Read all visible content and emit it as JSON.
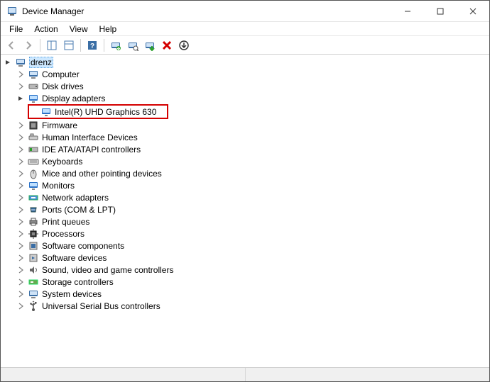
{
  "window": {
    "title": "Device Manager"
  },
  "menu": {
    "file": "File",
    "action": "Action",
    "view": "View",
    "help": "Help"
  },
  "tree": {
    "root": "drenz",
    "computer": "Computer",
    "disk_drives": "Disk drives",
    "display_adapters": "Display adapters",
    "intel_gpu": "Intel(R) UHD Graphics 630",
    "firmware": "Firmware",
    "hid": "Human Interface Devices",
    "ide": "IDE ATA/ATAPI controllers",
    "keyboards": "Keyboards",
    "mice": "Mice and other pointing devices",
    "monitors": "Monitors",
    "network": "Network adapters",
    "ports": "Ports (COM & LPT)",
    "print_queues": "Print queues",
    "processors": "Processors",
    "soft_components": "Software components",
    "soft_devices": "Software devices",
    "sound": "Sound, video and game controllers",
    "storage": "Storage controllers",
    "system": "System devices",
    "usb": "Universal Serial Bus controllers"
  }
}
